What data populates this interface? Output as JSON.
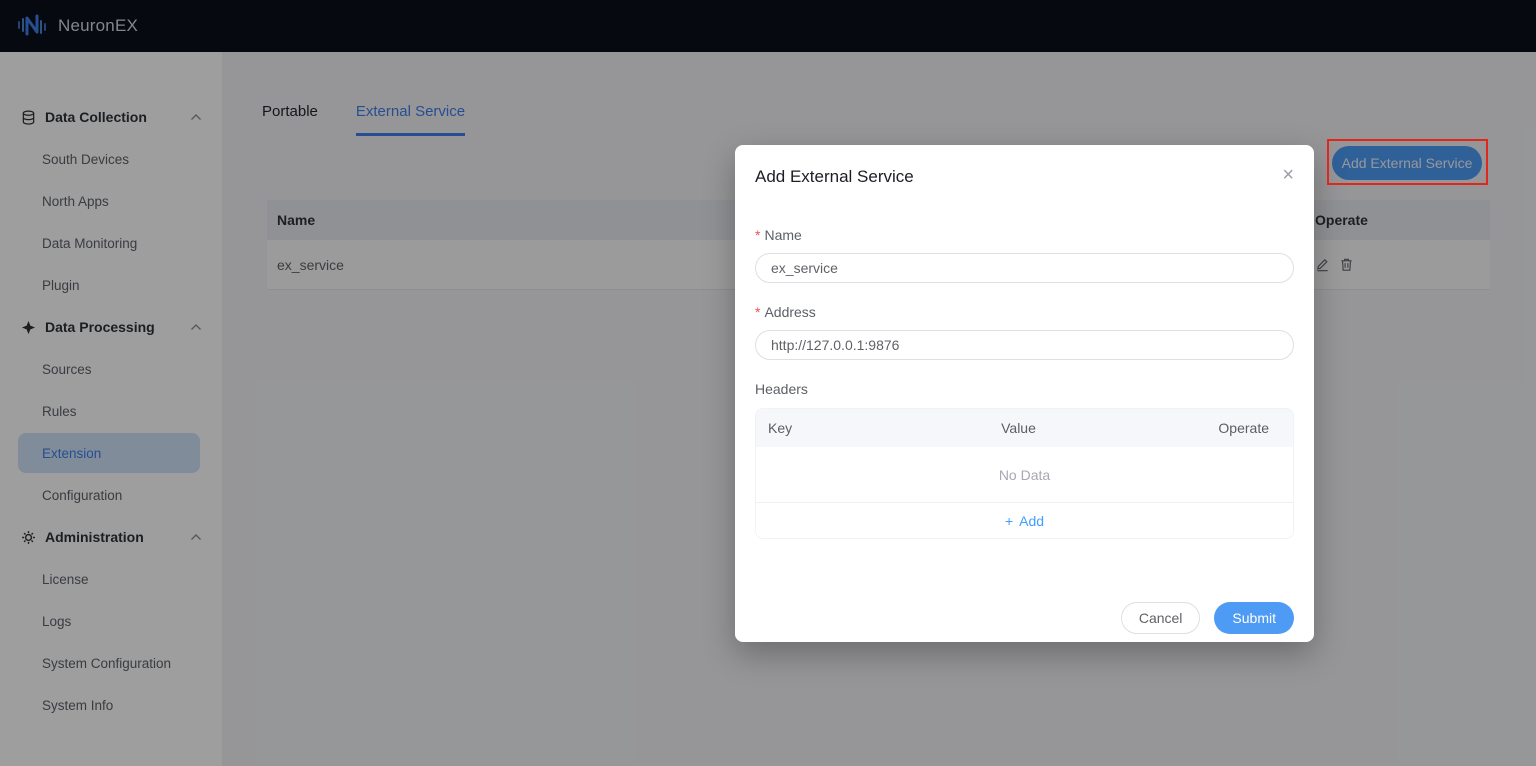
{
  "navbar": {
    "brand": "NeuronEX"
  },
  "sidebar": {
    "active_item": "Extension",
    "sections": [
      {
        "label": "Data Collection",
        "icon": "database-icon",
        "children": [
          "South Devices",
          "North Apps",
          "Data Monitoring",
          "Plugin"
        ]
      },
      {
        "label": "Data Processing",
        "icon": "spark-icon",
        "children": [
          "Sources",
          "Rules",
          "Extension",
          "Configuration"
        ]
      },
      {
        "label": "Administration",
        "icon": "gear-icon",
        "children": [
          "License",
          "Logs",
          "System Configuration",
          "System Info"
        ]
      }
    ]
  },
  "tabs": [
    {
      "label": "Portable",
      "active": false
    },
    {
      "label": "External Service",
      "active": true
    }
  ],
  "toolbar": {
    "add_button_label": "Add External Service"
  },
  "table": {
    "columns": [
      "Name",
      "Operate"
    ],
    "rows": [
      {
        "name": "ex_service"
      }
    ]
  },
  "modal": {
    "title": "Add External Service",
    "close_glyph": "×",
    "required_marker": "*",
    "fields": [
      {
        "label": "Name",
        "required": true,
        "value": "ex_service"
      },
      {
        "label": "Address",
        "required": true,
        "value": "http://127.0.0.1:9876"
      }
    ],
    "headers_section": {
      "label": "Headers",
      "columns": [
        "Key",
        "Value",
        "Operate"
      ],
      "empty_text": "No Data",
      "add_glyph": "+",
      "add_label": "Add"
    },
    "footer": {
      "cancel_label": "Cancel",
      "submit_label": "Submit"
    }
  },
  "colors": {
    "primary_blue": "#4e9bf5",
    "link_blue": "#409eff",
    "active_item_bg": "#cfe3f9",
    "active_item_text": "#3f7ee8",
    "navbar_bg": "#0a0f1b",
    "annotation_red": "#e1261c",
    "required_red": "#f24f4f"
  }
}
